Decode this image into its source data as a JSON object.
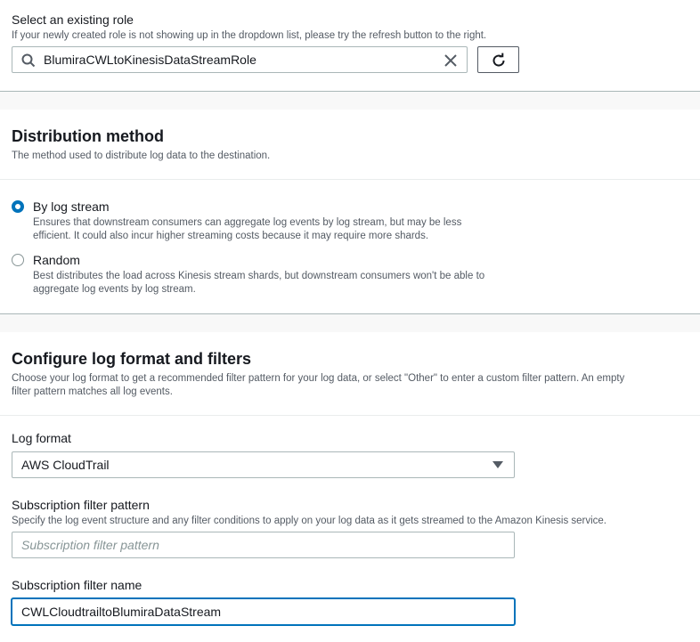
{
  "role": {
    "label": "Select an existing role",
    "description": "If your newly created role is not showing up in the dropdown list, please try the refresh button to the right.",
    "value": "BlumiraCWLtoKinesisDataStreamRole"
  },
  "distribution": {
    "heading": "Distribution method",
    "description": "The method used to distribute log data to the destination.",
    "options": [
      {
        "label": "By log stream",
        "description_line1": "Ensures that downstream consumers can aggregate log events by log stream, but may be less",
        "description_line2": "efficient. It could also incur higher streaming costs because it may require more shards.",
        "selected": true
      },
      {
        "label": "Random",
        "description_line1": "Best distributes the load across Kinesis stream shards, but downstream consumers won't be able to",
        "description_line2": "aggregate log events by log stream.",
        "selected": false
      }
    ]
  },
  "log_format": {
    "heading": "Configure log format and filters",
    "description_line1": "Choose your log format to get a recommended filter pattern for your log data, or select \"Other\" to enter a custom filter pattern. An empty",
    "description_line2": "filter pattern matches all log events.",
    "format_label": "Log format",
    "format_value": "AWS CloudTrail",
    "pattern_label": "Subscription filter pattern",
    "pattern_description": "Specify the log event structure and any filter conditions to apply on your log data as it gets streamed to the Amazon Kinesis service.",
    "pattern_placeholder": "Subscription filter pattern",
    "name_label": "Subscription filter name",
    "name_value": "CWLCloudtrailtoBlumiraDataStream"
  },
  "colors": {
    "accent": "#0073bb",
    "border": "#aab7b8",
    "text": "#16191f",
    "muted": "#545b64"
  }
}
